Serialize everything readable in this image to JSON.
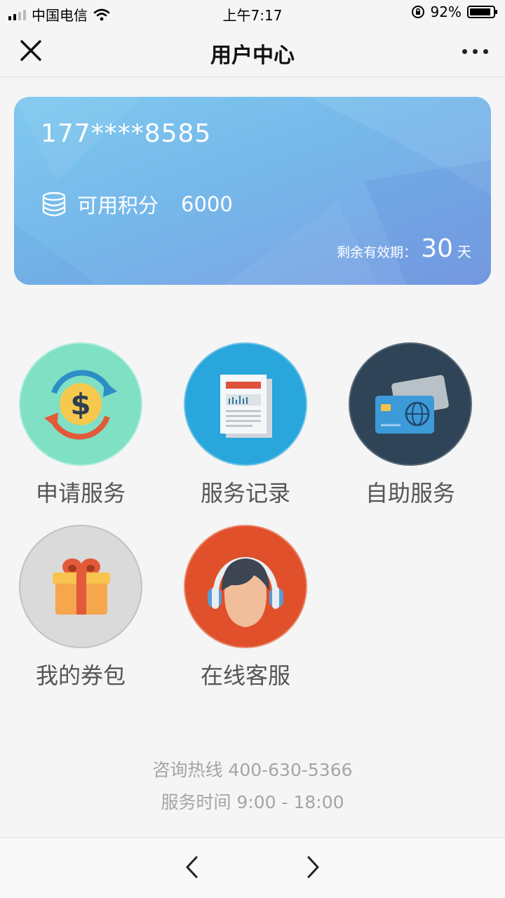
{
  "status": {
    "carrier": "中国电信",
    "time": "上午7:17",
    "battery": "92%",
    "battery_level": 0.92
  },
  "nav": {
    "title": "用户中心",
    "close_icon": "close-icon",
    "more_icon": "more-icon"
  },
  "card": {
    "phone": "177****8585",
    "points_label": "可用积分",
    "points_value": "6000",
    "validity_label": "剩余有效期：",
    "validity_days": "30",
    "validity_unit": "天",
    "gradient": [
      "#7fc9ef",
      "#7d9ee3"
    ]
  },
  "menu": [
    {
      "label": "申请服务",
      "icon": "dollar-exchange-icon",
      "color": "#7fe0c4"
    },
    {
      "label": "服务记录",
      "icon": "newspaper-icon",
      "color": "#29a6dc"
    },
    {
      "label": "自助服务",
      "icon": "credit-card-icon",
      "color": "#2f4457"
    },
    {
      "label": "我的券包",
      "icon": "gift-icon",
      "color": "#dadada"
    },
    {
      "label": "在线客服",
      "icon": "headset-agent-icon",
      "color": "#e0502b"
    }
  ],
  "footer": {
    "hotline": "咨询热线 400-630-5366",
    "hours": "服务时间 9:00 - 18:00"
  },
  "bottom": {
    "back_icon": "chevron-left-icon",
    "forward_icon": "chevron-right-icon"
  }
}
